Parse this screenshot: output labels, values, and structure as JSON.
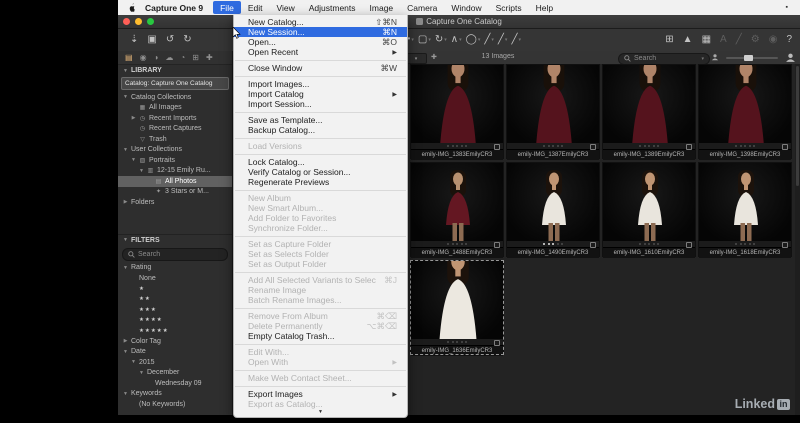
{
  "menu_bar": {
    "app_name": "Capture One 9",
    "items": [
      {
        "label": "File",
        "active": true
      },
      {
        "label": "Edit"
      },
      {
        "label": "View"
      },
      {
        "label": "Adjustments"
      },
      {
        "label": "Image"
      },
      {
        "label": "Camera"
      },
      {
        "label": "Window"
      },
      {
        "label": "Scripts"
      },
      {
        "label": "Help"
      }
    ]
  },
  "window": {
    "title": "Capture One Catalog"
  },
  "file_menu": {
    "items": [
      {
        "label": "New Catalog...",
        "shortcut": "⇧⌘N"
      },
      {
        "label": "New Session...",
        "shortcut": "⌘N",
        "highlighted": true
      },
      {
        "label": "Open...",
        "shortcut": "⌘O"
      },
      {
        "label": "Open Recent",
        "submenu": true
      },
      {
        "type": "sep"
      },
      {
        "label": "Close Window",
        "shortcut": "⌘W"
      },
      {
        "type": "sep"
      },
      {
        "label": "Import Images..."
      },
      {
        "label": "Import Catalog",
        "submenu": true
      },
      {
        "label": "Import Session..."
      },
      {
        "type": "sep"
      },
      {
        "label": "Save as Template..."
      },
      {
        "label": "Backup Catalog..."
      },
      {
        "type": "sep"
      },
      {
        "label": "Load Versions",
        "disabled": true
      },
      {
        "type": "sep"
      },
      {
        "label": "Lock Catalog..."
      },
      {
        "label": "Verify Catalog or Session..."
      },
      {
        "label": "Regenerate Previews"
      },
      {
        "type": "sep"
      },
      {
        "label": "New Album",
        "disabled": true
      },
      {
        "label": "New Smart Album...",
        "disabled": true
      },
      {
        "label": "Add Folder to Favorites",
        "disabled": true
      },
      {
        "label": "Synchronize Folder...",
        "disabled": true
      },
      {
        "type": "sep"
      },
      {
        "label": "Set as Capture Folder",
        "disabled": true
      },
      {
        "label": "Set as Selects Folder",
        "disabled": true
      },
      {
        "label": "Set as Output Folder",
        "disabled": true
      },
      {
        "type": "sep"
      },
      {
        "label": "Add All Selected Variants to Selects Album",
        "shortcut": "⌘J",
        "disabled": true
      },
      {
        "label": "Rename Image",
        "disabled": true
      },
      {
        "label": "Batch Rename Images...",
        "disabled": true
      },
      {
        "type": "sep"
      },
      {
        "label": "Remove From Album",
        "shortcut": "⌘⌫",
        "disabled": true
      },
      {
        "label": "Delete Permanently",
        "shortcut": "⌥⌘⌫",
        "disabled": true
      },
      {
        "label": "Empty Catalog Trash..."
      },
      {
        "type": "sep"
      },
      {
        "label": "Edit With...",
        "disabled": true
      },
      {
        "label": "Open With",
        "disabled": true,
        "submenu": true
      },
      {
        "type": "sep"
      },
      {
        "label": "Make Web Contact Sheet...",
        "disabled": true
      },
      {
        "type": "sep"
      },
      {
        "label": "Export Images",
        "submenu": true
      },
      {
        "label": "Export as Catalog...",
        "disabled": true
      }
    ],
    "scroll_indicator": "▼"
  },
  "toolbar": {
    "left_icons": [
      {
        "name": "import-icon",
        "glyph": "⇣"
      },
      {
        "name": "camera-icon",
        "glyph": "▣"
      },
      {
        "name": "rotate-ccw-icon",
        "glyph": "↺"
      },
      {
        "name": "rotate-cw-icon",
        "glyph": "↻"
      }
    ],
    "tools": [
      {
        "name": "pan-tool-icon",
        "glyph": "✚"
      },
      {
        "name": "crop-tool-icon",
        "glyph": "▢"
      },
      {
        "name": "rotate-tool-icon",
        "glyph": "↻"
      },
      {
        "name": "straighten-tool-icon",
        "glyph": "∧"
      },
      {
        "name": "spot-tool-icon",
        "glyph": "◯"
      },
      {
        "name": "draw-mask-tool-icon",
        "glyph": "╱"
      },
      {
        "name": "erase-mask-tool-icon",
        "glyph": "╱"
      },
      {
        "name": "gradient-mask-tool-icon",
        "glyph": "╱"
      }
    ],
    "right_icons": [
      {
        "name": "grid-view-icon",
        "glyph": "⊞"
      },
      {
        "name": "exposure-warning-icon",
        "glyph": "▲"
      },
      {
        "name": "proof-view-icon",
        "glyph": "▦"
      },
      {
        "name": "annotation-icon",
        "glyph": "A",
        "dim": true
      },
      {
        "name": "pencil-icon",
        "glyph": "╱",
        "dim": true
      },
      {
        "name": "gear-icon",
        "glyph": "⚙",
        "dim": true
      },
      {
        "name": "focus-mask-icon",
        "glyph": "◉",
        "dim": true
      },
      {
        "name": "help-icon",
        "glyph": "?"
      }
    ]
  },
  "sidebar": {
    "tool_tabs": [
      {
        "name": "library-tab",
        "glyph": "▤",
        "active": true
      },
      {
        "name": "capture-tab",
        "glyph": "◉"
      },
      {
        "name": "color-tab",
        "glyph": "◑"
      },
      {
        "name": "cloud-tab",
        "glyph": "☁"
      },
      {
        "name": "exposure-tab",
        "glyph": "◔"
      },
      {
        "name": "details-tab",
        "glyph": "⊞"
      },
      {
        "name": "adjustments-tab",
        "glyph": "✚"
      }
    ],
    "library_header": "LIBRARY",
    "catalog_selector": "Catalog: Capture One Catalog",
    "tree": [
      {
        "label": "Catalog Collections",
        "depth": 0,
        "disc": "▼"
      },
      {
        "label": "All Images",
        "depth": 1,
        "icon": "all-images-icon"
      },
      {
        "label": "Recent Imports",
        "depth": 1,
        "disc": "▶",
        "icon": "clock-icon"
      },
      {
        "label": "Recent Captures",
        "depth": 1,
        "icon": "clock-icon"
      },
      {
        "label": "Trash",
        "depth": 1,
        "icon": "trash-icon"
      },
      {
        "label": "User Collections",
        "depth": 0,
        "disc": "▼"
      },
      {
        "label": "Portraits",
        "depth": 1,
        "disc": "▼",
        "icon": "folder-icon"
      },
      {
        "label": "12-15 Emily Ru...",
        "depth": 2,
        "disc": "▼",
        "icon": "group-icon"
      },
      {
        "label": "All Photos",
        "depth": 3,
        "icon": "album-icon",
        "selected": true
      },
      {
        "label": "3 Stars or M...",
        "depth": 3,
        "icon": "smart-album-icon"
      },
      {
        "label": "Folders",
        "depth": 0,
        "disc": "▶"
      }
    ],
    "filters_header": "FILTERS",
    "search_placeholder": "Search",
    "filter_tree": [
      {
        "label": "Rating",
        "depth": 0,
        "disc": "▼"
      },
      {
        "label": "None",
        "depth": 1
      },
      {
        "stars": 1,
        "depth": 1
      },
      {
        "stars": 2,
        "depth": 1
      },
      {
        "stars": 3,
        "depth": 1
      },
      {
        "stars": 4,
        "depth": 1
      },
      {
        "stars": 5,
        "depth": 1
      },
      {
        "label": "Color Tag",
        "depth": 0,
        "disc": "▶"
      },
      {
        "label": "Date",
        "depth": 0,
        "disc": "▼"
      },
      {
        "label": "2015",
        "depth": 1,
        "disc": "▼"
      },
      {
        "label": "December",
        "depth": 2,
        "disc": "▼"
      },
      {
        "label": "Wednesday 09",
        "depth": 3
      },
      {
        "label": "Keywords",
        "depth": 0,
        "disc": "▼"
      },
      {
        "label": "(No Keywords)",
        "depth": 1
      }
    ]
  },
  "browser": {
    "image_count": "13 Images",
    "search_placeholder": "Search",
    "thumbnails": [
      {
        "filename": "emily-IMG_1383EmilyCR3",
        "dots_filled": 0,
        "style": "dark-close"
      },
      {
        "filename": "emily-IMG_1387EmilyCR3",
        "dots_filled": 0,
        "style": "dark-close"
      },
      {
        "filename": "emily-IMG_1389EmilyCR3",
        "dots_filled": 0,
        "style": "dark-close"
      },
      {
        "filename": "emily-IMG_1398EmilyCR3",
        "dots_filled": 0,
        "style": "dark-close"
      },
      {
        "filename": "emily-IMG_1488EmilyCR3",
        "dots_filled": 0,
        "style": "red-dress"
      },
      {
        "filename": "emily-IMG_1490EmilyCR3",
        "dots_filled": 3,
        "style": "white-full"
      },
      {
        "filename": "emily-IMG_1610EmilyCR3",
        "dots_filled": 0,
        "style": "white-full"
      },
      {
        "filename": "emily-IMG_1618EmilyCR3",
        "dots_filled": 0,
        "style": "white-full"
      },
      {
        "filename": "emily-IMG_1636EmilyCR3",
        "dots_filled": 0,
        "style": "white-close",
        "selected": true
      }
    ]
  },
  "watermark": {
    "text": "Linked",
    "badge": "in"
  },
  "colors": {
    "menu_highlight": "#2f6be0",
    "selection_gray": "#616161",
    "tab_active": "#e8b87a"
  }
}
